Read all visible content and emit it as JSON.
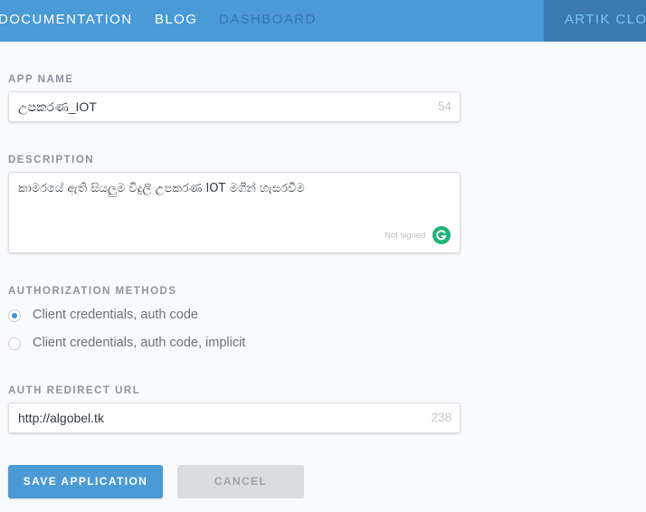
{
  "nav": {
    "documentation": "DOCUMENTATION",
    "blog": "BLOG",
    "dashboard": "DASHBOARD",
    "artik_cloud": "ARTIK CLOUD"
  },
  "form": {
    "app_name": {
      "label": "APP NAME",
      "value": "උපකරණ_IOT",
      "remaining": "54"
    },
    "description": {
      "label": "DESCRIPTION",
      "value": "කාමරයේ ඇති සියලුම විදුලි උපකරණ IOT  මගින් හැසරවීම",
      "grammarly_status": "Not signed"
    },
    "authorization": {
      "label": "AUTHORIZATION METHODS",
      "options": [
        {
          "label": "Client credentials, auth code",
          "selected": true
        },
        {
          "label": "Client credentials, auth code, implicit",
          "selected": false
        }
      ]
    },
    "redirect_url": {
      "label": "AUTH REDIRECT URL",
      "value": "http://algobel.tk",
      "remaining": "238"
    }
  },
  "buttons": {
    "save": "SAVE APPLICATION",
    "cancel": "CANCEL"
  },
  "colors": {
    "primary": "#4a9ad6",
    "nav_active_bg": "#3b79b1",
    "grammarly_green": "#1fb37a"
  },
  "icons": {
    "grammarly": "grammarly-g-icon"
  }
}
